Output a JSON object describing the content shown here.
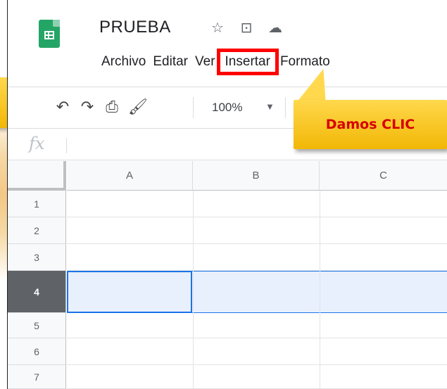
{
  "app": {
    "doc_title": "PRUEBA"
  },
  "title_icons": [
    "star-icon",
    "move-to-folder-icon",
    "cloud-saved-icon"
  ],
  "menu": [
    "Archivo",
    "Editar",
    "Ver",
    "Insertar",
    "Formato"
  ],
  "highlighted_menu": "Insertar",
  "toolbar": {
    "icons": [
      "undo-icon",
      "redo-icon",
      "print-icon",
      "paint-format-icon"
    ],
    "zoom": "100%"
  },
  "formula_bar": {
    "fx": "fx",
    "value": ""
  },
  "columns": [
    "A",
    "B",
    "C"
  ],
  "rows": [
    "1",
    "2",
    "3",
    "4",
    "5",
    "6",
    "7"
  ],
  "selected_row": "4",
  "active_cell": "A4",
  "callout": {
    "text": "Damos CLIC"
  },
  "colors": {
    "highlight_box": "#ff0000",
    "callout_fill": "#ffd84d",
    "callout_text": "#d60000",
    "sheets_green": "#23a566",
    "selection_blue": "#1a73e8"
  }
}
